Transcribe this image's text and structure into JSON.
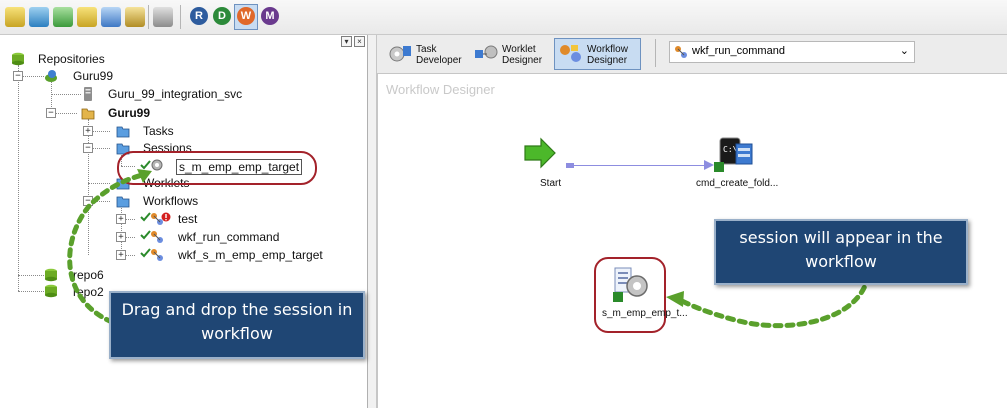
{
  "toolbar": {
    "round_buttons": [
      "R",
      "D",
      "W",
      "M"
    ]
  },
  "tree": {
    "root": "Repositories",
    "repo_main": "Guru99",
    "integration_service": "Guru_99_integration_svc",
    "folder": "Guru99",
    "tasks": "Tasks",
    "sessions": "Sessions",
    "session_item": "s_m_emp_emp_target",
    "worklets": "Worklets",
    "workflows": "Workflows",
    "workflow_items": [
      "test",
      "wkf_run_command",
      "wkf_s_m_emp_emp_target"
    ],
    "repo6": "repo6",
    "repo2": "repo2"
  },
  "tabs": [
    {
      "line1": "Task",
      "line2": "Developer"
    },
    {
      "line1": "Worklet",
      "line2": "Designer"
    },
    {
      "line1": "Workflow",
      "line2": "Designer"
    }
  ],
  "workflow_select": "wkf_run_command",
  "canvas": {
    "title": "Workflow Designer",
    "start_label": "Start",
    "cmd_label": "cmd_create_fold...",
    "session_label": "s_m_emp_emp_t..."
  },
  "annotations": {
    "left_line1": "Drag and drop the session in",
    "left_line2": "workflow",
    "right_line1": "session will appear in the",
    "right_line2": "workflow"
  },
  "colors": {
    "callout_bg": "#1f4674",
    "highlight_ring": "#a3222a",
    "arrow_green": "#5aa02c",
    "active_tab": "#c8dcf2"
  }
}
